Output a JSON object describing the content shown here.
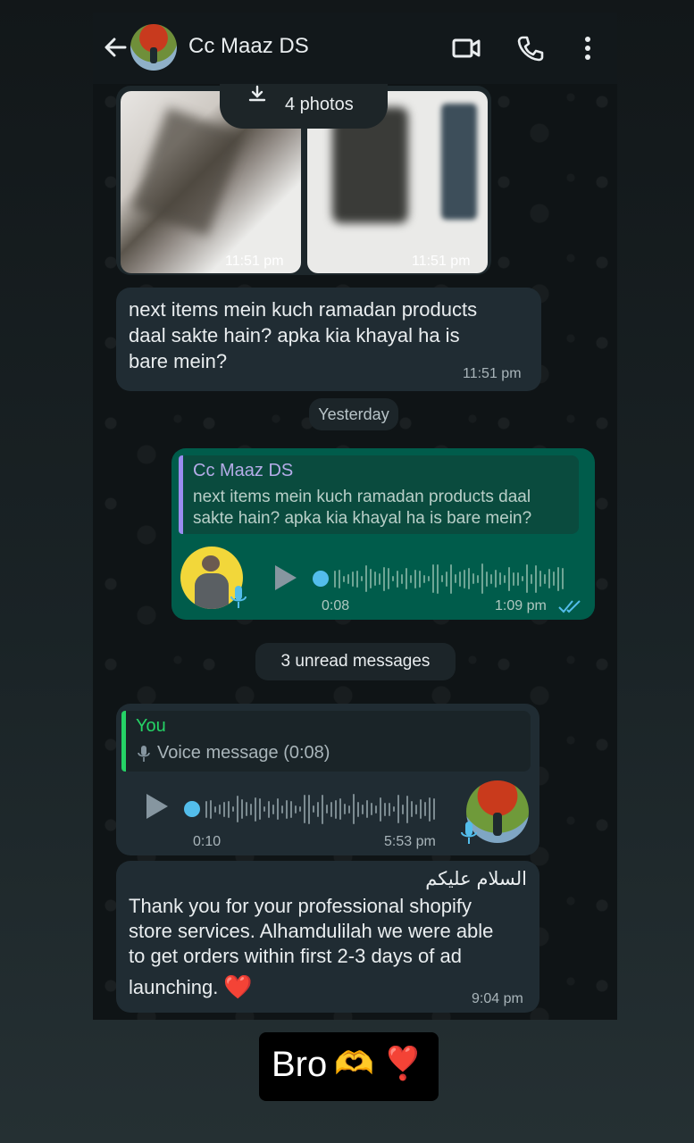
{
  "header": {
    "contact_name": "Cc Maaz DS"
  },
  "photos_pill": {
    "label": "4 photos"
  },
  "photos": [
    {
      "time": "11:51 pm"
    },
    {
      "time": "11:51 pm"
    }
  ],
  "message1": {
    "text": "next items mein kuch ramadan products daal sakte hain? apka kia khayal ha is bare mein?",
    "line1": "next items mein kuch ramadan products",
    "line2": "daal sakte hain? apka kia khayal ha is",
    "line3": "bare mein?",
    "time": "11:51 pm"
  },
  "date_separator": {
    "label": "Yesterday"
  },
  "outgoing_voice": {
    "quote_author": "Cc Maaz DS",
    "quote_line1": "next items mein kuch ramadan products daal",
    "quote_line2": "sakte hain? apka kia khayal ha is bare mein?",
    "duration": "0:08",
    "time": "1:09 pm"
  },
  "unread_separator": {
    "label": "3 unread messages"
  },
  "incoming_voice": {
    "quote_author": "You",
    "quote_text": "Voice message (0:08)",
    "duration": "0:10",
    "time": "5:53 pm"
  },
  "message_final": {
    "greeting": "السلام علیکم",
    "line1": "Thank you for your professional shopify",
    "line2": "store services. Alhamdulilah we were able",
    "line3": "to get orders within first 2-3 days of ad",
    "line4": "launching.",
    "heart": "❤️",
    "time": "9:04 pm"
  },
  "story_caption": {
    "text": "Bro",
    "emoji": "🫶 ❣️"
  },
  "colors": {
    "outgoing_bubble": "#005c4b",
    "incoming_bubble": "#202c33",
    "accent_blue": "#53bdeb",
    "quote_purple": "#9a8cf0",
    "quote_green": "#25d366"
  },
  "icons": [
    "back-arrow-icon",
    "video-call-icon",
    "phone-icon",
    "more-options-icon",
    "download-icon",
    "play-icon",
    "mic-icon",
    "double-check-icon"
  ]
}
